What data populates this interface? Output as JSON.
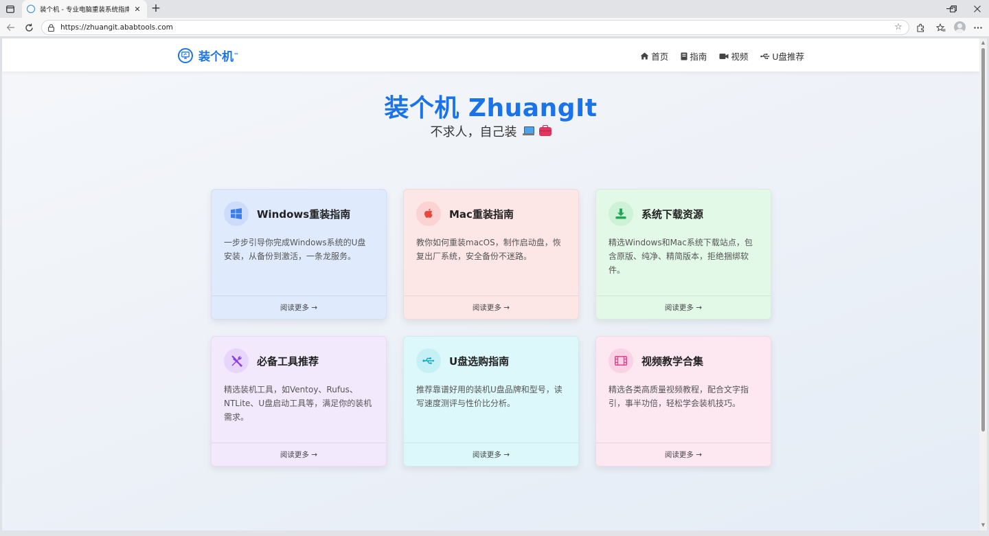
{
  "browser": {
    "tab_title": "装个机 - 专业电脑重装系统指南教",
    "url": "https://zhuangit.ababtools.com"
  },
  "header": {
    "logo_text": "装个机",
    "logo_tm": "™",
    "nav": [
      {
        "label": "首页",
        "icon": "home-icon"
      },
      {
        "label": "指南",
        "icon": "book-icon"
      },
      {
        "label": "视频",
        "icon": "video-icon"
      },
      {
        "label": "U盘推荐",
        "icon": "usb-icon"
      }
    ]
  },
  "hero": {
    "title": "装个机 ZhuangIt",
    "subtitle": "不求人，自己装"
  },
  "cards": [
    {
      "title": "Windows重装指南",
      "desc": "一步步引导你完成Windows系统的U盘安装，从备份到激活，一条龙服务。",
      "link": "阅读更多 →",
      "icon": "windows-icon",
      "bg": "#dfeafd",
      "icon_bg": "#cddcfb",
      "icon_color": "#3b7de9"
    },
    {
      "title": "Mac重装指南",
      "desc": "教你如何重装macOS，制作启动盘，恢复出厂系统，安全备份不迷路。",
      "link": "阅读更多 →",
      "icon": "apple-icon",
      "bg": "#fde6e6",
      "icon_bg": "#fbd3d3",
      "icon_color": "#e8483f"
    },
    {
      "title": "系统下载资源",
      "desc": "精选Windows和Mac系统下载站点，包含原版、纯净、精简版本，拒绝捆绑软件。",
      "link": "阅读更多 →",
      "icon": "download-icon",
      "bg": "#e3f9e8",
      "icon_bg": "#cdf2d6",
      "icon_color": "#22a858"
    },
    {
      "title": "必备工具推荐",
      "desc": "精选装机工具，如Ventoy、Rufus、NTLite、U盘启动工具等，满足你的装机需求。",
      "link": "阅读更多 →",
      "icon": "tools-icon",
      "bg": "#f3e9fd",
      "icon_bg": "#e7d5fb",
      "icon_color": "#8a3fe0"
    },
    {
      "title": "U盘选购指南",
      "desc": "推荐靠谱好用的装机U盘品牌和型号，读写速度测评与性价比分析。",
      "link": "阅读更多 →",
      "icon": "usb-icon",
      "bg": "#dcf8fb",
      "icon_bg": "#c5f1f6",
      "icon_color": "#14a8c4"
    },
    {
      "title": "视频教学合集",
      "desc": "精选各类高质量视频教程，配合文字指引，事半功倍，轻松学会装机技巧。",
      "link": "阅读更多 →",
      "icon": "film-icon",
      "bg": "#fde7f1",
      "icon_bg": "#fad2e5",
      "icon_color": "#e0438c"
    }
  ]
}
